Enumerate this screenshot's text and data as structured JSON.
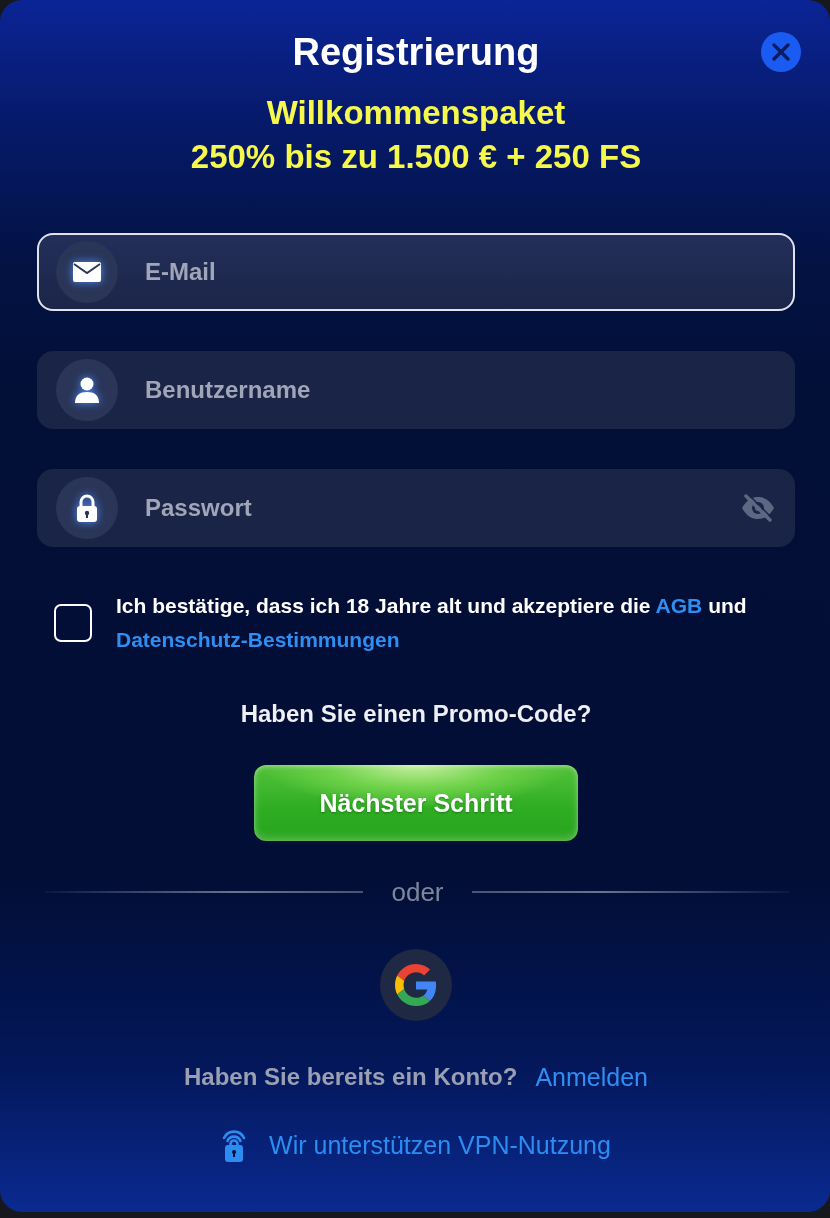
{
  "dialog": {
    "title": "Registrierung"
  },
  "promo": {
    "lines": [
      "Willkommenspaket",
      "250% bis zu 1.500 € + 250 FS"
    ]
  },
  "fields": [
    {
      "kind": "email",
      "placeholder": "E-Mail",
      "focused": true
    },
    {
      "kind": "username",
      "placeholder": "Benutzername",
      "focused": false
    },
    {
      "kind": "password",
      "placeholder": "Passwort",
      "focused": false,
      "password_visible": false
    }
  ],
  "terms": {
    "checked": false,
    "parts": [
      {
        "kind": "text",
        "text": "Ich bestätige, dass ich 18 Jahre alt und akzeptiere die"
      },
      {
        "kind": "link",
        "text": "AGB"
      },
      {
        "kind": "text",
        "text": "und"
      },
      {
        "kind": "link",
        "text": "Datenschutz-Bestimmungen"
      }
    ]
  },
  "promo_code_prompt": "Haben Sie einen Promo-Code?",
  "submit_button": "Nächster Schritt",
  "divider": "oder",
  "login_prompt": {
    "text": "Haben Sie bereits ein Konto?",
    "link": "Anmelden"
  },
  "vpn_notice": "Wir unterstützen VPN-Nutzung"
}
